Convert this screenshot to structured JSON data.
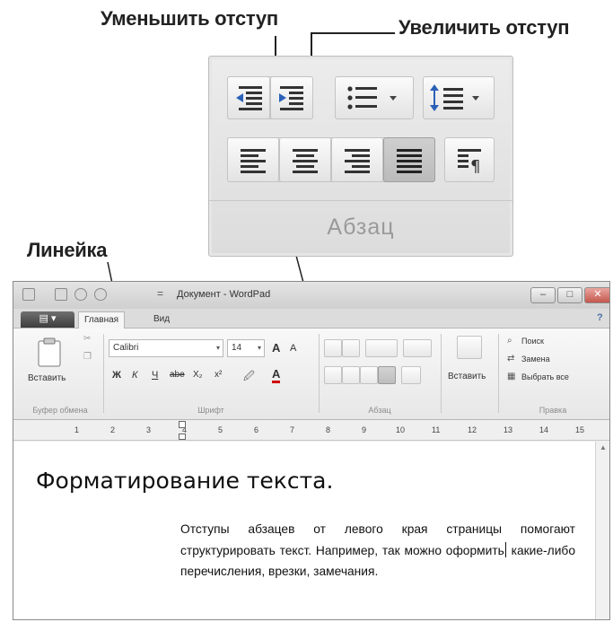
{
  "callouts": {
    "decrease_indent": "Уменьшить отступ",
    "increase_indent": "Увеличить отступ",
    "ruler": "Линейка"
  },
  "paragraph_group": {
    "caption": "Абзац",
    "icons": [
      "decrease-indent-icon",
      "increase-indent-icon",
      "bullet-list-icon",
      "line-spacing-icon",
      "align-left-icon",
      "align-center-icon",
      "align-right-icon",
      "justify-icon",
      "paragraph-settings-icon"
    ]
  },
  "window": {
    "title": "Документ - WordPad",
    "controls": {
      "minimize": "–",
      "maximize": "□",
      "close": "✕"
    },
    "tabs": [
      {
        "label": "Главная",
        "active": true
      },
      {
        "label": "Вид",
        "active": false
      }
    ],
    "help_icon": "?",
    "clipboard": {
      "paste": "Вставить",
      "group": "Буфер обмена"
    },
    "font": {
      "family": "Calibri",
      "size": "14",
      "grow": "A",
      "shrink": "A",
      "bold": "Ж",
      "italic": "К",
      "underline": "Ч",
      "strike": "abe",
      "subscript": "X₂",
      "superscript": "x²",
      "highlight": "🖉",
      "color": "A",
      "group": "Шрифт"
    },
    "paragraph": {
      "group": "Абзац"
    },
    "insert": {
      "label": "Вставить"
    },
    "editing": {
      "find": "Поиск",
      "replace": "Замена",
      "select_all": "Выбрать все",
      "group": "Правка"
    },
    "ruler_ticks": [
      "1",
      "2",
      "3",
      "4",
      "5",
      "6",
      "7",
      "8",
      "9",
      "10",
      "11",
      "12",
      "13",
      "14",
      "15"
    ],
    "document": {
      "heading": "Форматирование текста.",
      "paragraph_before_caret": "Отступы абзацев от левого края страницы помогают структурировать текст. Например, так можно оформить",
      "paragraph_after_caret": " какие-либо перечисления, врезки, замечания."
    }
  },
  "colors": {
    "ribbon": "#efefef",
    "font_color_underline": "#d00000",
    "active_button": "#c4c4c4"
  }
}
